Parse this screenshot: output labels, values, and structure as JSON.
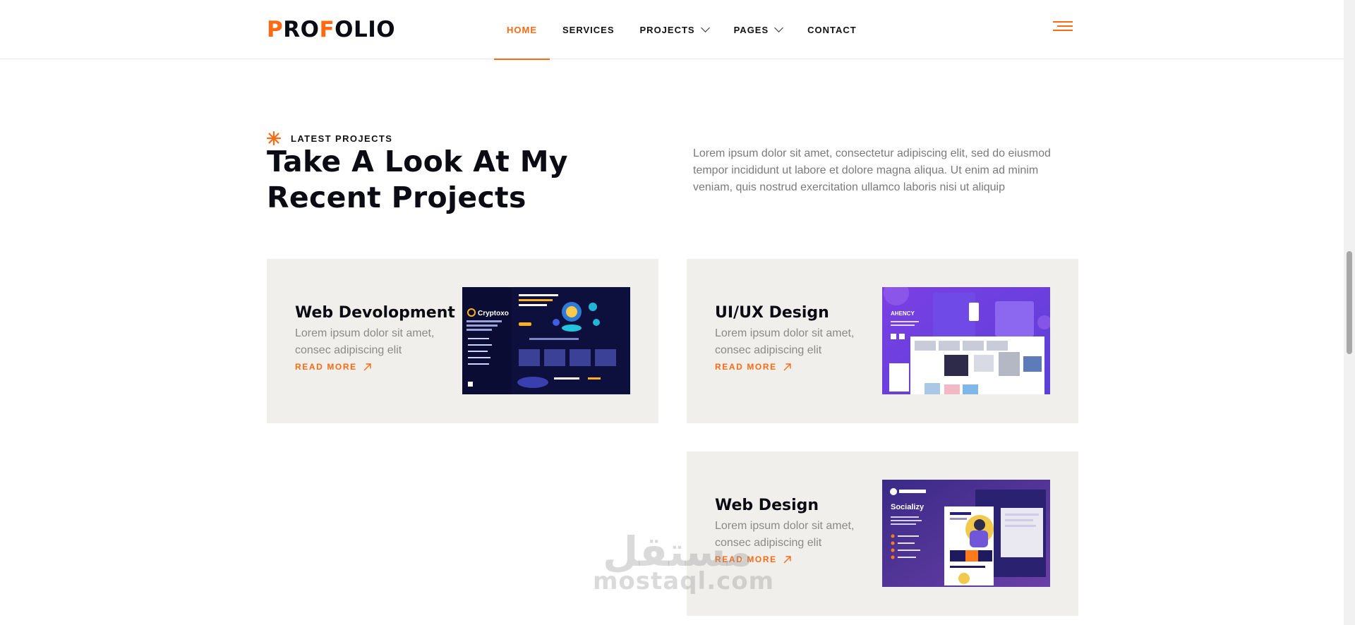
{
  "header": {
    "logo_parts": [
      "P",
      "RO",
      "F",
      "OLIO"
    ],
    "nav": [
      {
        "label": "HOME",
        "active": true
      },
      {
        "label": "SERVICES"
      },
      {
        "label": "PROJECTS",
        "dropdown": true
      },
      {
        "label": "PAGES",
        "dropdown": true
      },
      {
        "label": "CONTACT"
      }
    ],
    "menu_icon": "hamburger-icon"
  },
  "section": {
    "eyebrow": "LATEST PROJECTS",
    "title": "Take A Look At My Recent Projects",
    "description": "Lorem ipsum dolor sit amet, consectetur adipiscing elit, sed do eiusmod tempor incididunt ut labore et dolore magna aliqua. Ut enim ad minim veniam, quis nostrud exercitation ullamco laboris nisi ut aliquip"
  },
  "projects": [
    {
      "title": "Web Devolopment",
      "description": "Lorem ipsum dolor sit amet, consec adipiscing elit",
      "link": "READ MORE",
      "thumb_brand": "Cryptoxo"
    },
    {
      "title": "UI/UX Design",
      "description": "Lorem ipsum dolor sit amet, consec adipiscing elit",
      "link": "READ MORE",
      "thumb_brand": "AHENCY"
    },
    {
      "title": "Web Design",
      "description": "Lorem ipsum dolor sit amet, consec adipiscing elit",
      "link": "READ MORE",
      "thumb_brand": "Socializy"
    }
  ],
  "watermark": {
    "arabic": "مستقل",
    "latin": "mostaql.com"
  },
  "colors": {
    "accent": "#ff6a13",
    "card_bg": "#f1efeb",
    "text": "#0b0b13",
    "muted": "#7a7a7a"
  }
}
